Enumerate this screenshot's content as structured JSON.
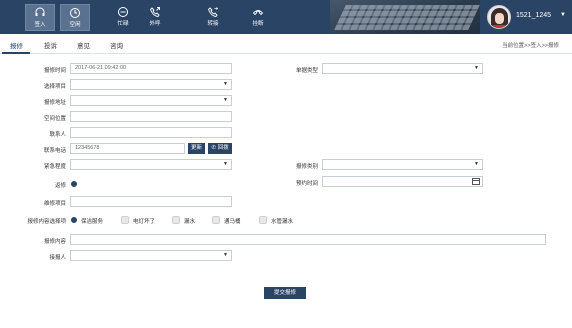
{
  "toolbar": {
    "items": [
      {
        "label": "签入",
        "icon": "headset-icon",
        "active": true
      },
      {
        "label": "空闲",
        "icon": "clock-icon",
        "active": true
      },
      {
        "label": "忙碌",
        "icon": "minus-circle-icon",
        "active": false
      },
      {
        "label": "外呼",
        "icon": "phone-out-icon",
        "active": false
      },
      {
        "label": "转接",
        "icon": "phone-transfer-icon",
        "active": false
      },
      {
        "label": "挂断",
        "icon": "hangup-icon",
        "active": false
      }
    ]
  },
  "user": {
    "name": "1521_1245",
    "caret": "▼"
  },
  "tabs": [
    "报修",
    "投诉",
    "意见",
    "咨询"
  ],
  "breadcrumb": "当前位置>>签入>>报修",
  "form": {
    "report_time_label": "报修时间",
    "report_time_value": "2017-06-21  09:42:00",
    "doc_type_label": "单据类型",
    "select_project_label": "选择项目",
    "report_address_label": "报修地址",
    "space_location_label": "空间位置",
    "contact_label": "联系人",
    "phone_label": "联系电话",
    "phone_value": "12345678",
    "update_btn": "更新",
    "callback_btn": "回拨",
    "urgency_label": "紧急程度",
    "repair_category_label": "报修类别",
    "return_visit_label": "返修",
    "appointment_label": "预约时间",
    "repair_item_label": "维修项目",
    "content_select_label": "报修内容选择项",
    "content_options": [
      "保洁服务",
      "电灯坏了",
      "漏水",
      "通马桶",
      "水管漏水"
    ],
    "content_label": "报修内容",
    "receiver_label": "接报人",
    "dropdown_glyph": "▼",
    "submit_btn": "提交报修"
  },
  "colors": {
    "brand": "#2a4466",
    "border": "#c9ced6"
  }
}
